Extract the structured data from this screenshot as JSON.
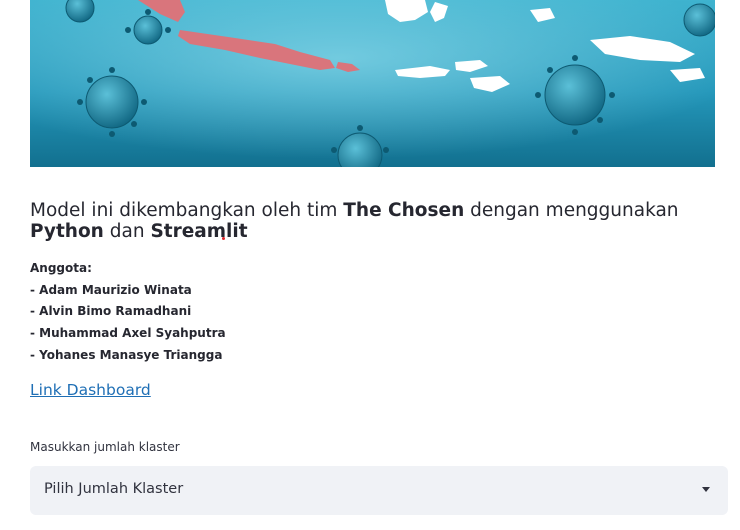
{
  "banner": {
    "image_name": "covid-indonesia-map-banner"
  },
  "headline": {
    "part1": "Model ini dikembangkan oleh tim ",
    "team": "The Chosen",
    "part2": " dengan menggunakan ",
    "tool1": "Python",
    "part3": " dan ",
    "tool2": "Streamlit"
  },
  "members": {
    "title": "Anggota:",
    "list": [
      "- Adam Maurizio Winata",
      "- Alvin Bimo Ramadhani",
      "- Muhammad Axel Syahputra",
      "- Yohanes Manasye Triangga"
    ]
  },
  "link": {
    "label": "Link Dashboard"
  },
  "cluster_select": {
    "label": "Masukkan jumlah klaster",
    "placeholder": "Pilih Jumlah Klaster",
    "chevron_icon": "chevron-down-icon"
  },
  "colors": {
    "link": "#1f6fb5",
    "select_bg": "#f0f2f6",
    "text": "#262730",
    "banner_sea": "#1c8fb0",
    "banner_land_highlight": "#e0747c"
  }
}
